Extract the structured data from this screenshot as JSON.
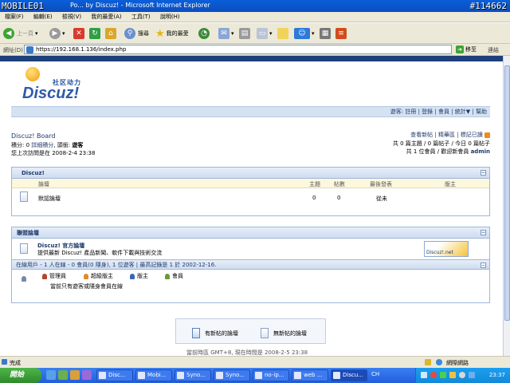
{
  "watermark": {
    "left": "MOBILE01",
    "id": "#114662"
  },
  "window": {
    "title": "Discuz! Board - Powered by Discuz! - Microsoft Internet Explorer",
    "title_visible": "Po... by Discuz! - Microsoft Internet Explorer"
  },
  "menubar": {
    "items": [
      "檔案(F)",
      "編輯(E)",
      "檢視(V)",
      "我的最愛(A)",
      "工具(T)",
      "說明(H)"
    ]
  },
  "toolbar": {
    "back": "上一頁",
    "search": "搜尋",
    "favorites": "我的最愛"
  },
  "address": {
    "label": "網址(D)",
    "url": "https://192.168.1.136/index.php",
    "go": "移至",
    "links": "連結"
  },
  "page": {
    "logo_cn": "社区动力",
    "logo_en": "Discuz!",
    "nav": {
      "user_label": "遊客:",
      "items": [
        "註冊",
        "登錄",
        "會員",
        "統計▼",
        "幫助"
      ]
    },
    "board_name": "Discuz! Board",
    "user_info_prefix": "積分: 0",
    "user_info_detail": "詳細積分",
    "user_info_group_label": "頭銜:",
    "user_info_group": "遊客",
    "last_visit": "您上次訪問是在 2008-2-4 23:38",
    "right_links": [
      "查看新帖",
      "精華區",
      "標記已讀"
    ],
    "stats1": "共 0 篇主題 / 0 篇帖子 / 今日 0 篇帖子",
    "stats2_prefix": "共 1 位會員 / 歡迎新會員",
    "stats2_user": "admin",
    "category": {
      "title": "Discuz!",
      "columns": {
        "forum": "論壇",
        "topics": "主題",
        "posts": "帖數",
        "last": "最後發表",
        "moderator": "版主"
      },
      "rows": [
        {
          "name": "默認論壇",
          "topics": "0",
          "posts": "0",
          "last": "從未",
          "moderator": ""
        }
      ]
    },
    "alliance": {
      "title": "聯盟論壇",
      "name": "Discuz! 官方論壇",
      "desc": "提供最新 Discuz! 產品新聞、軟件下載與技術交流",
      "banner": "Discuz!.net"
    },
    "online": {
      "header": "在線用戶 - 1 人在線 - 0 會員(0 隱身), 1 位遊客 | 最高記錄是 1 於 2002-12-16.",
      "legend": [
        "管理員",
        "超級版主",
        "版主",
        "會員"
      ],
      "note": "當前只有遊客或隱身會員在線"
    },
    "bottom": {
      "new_posts": "有新帖的論壇",
      "no_new_posts": "無新帖的論壇"
    },
    "footer": "當前時區 GMT+8, 現在時間是 2008-2-5 23:38"
  },
  "statusbar": {
    "status": "完成",
    "zone": "網際網路"
  },
  "taskbar": {
    "start": "開始",
    "tasks": [
      "Disc...",
      "Mobi...",
      "Syno...",
      "Syno...",
      "no-ip...",
      "web ...",
      "Discu..."
    ],
    "lang": "CH",
    "clock": "23:37"
  },
  "colors": {
    "nav_bg": "#d5e2f2",
    "box_border": "#9fb7d8",
    "title_blue": "#0b4dbf"
  }
}
